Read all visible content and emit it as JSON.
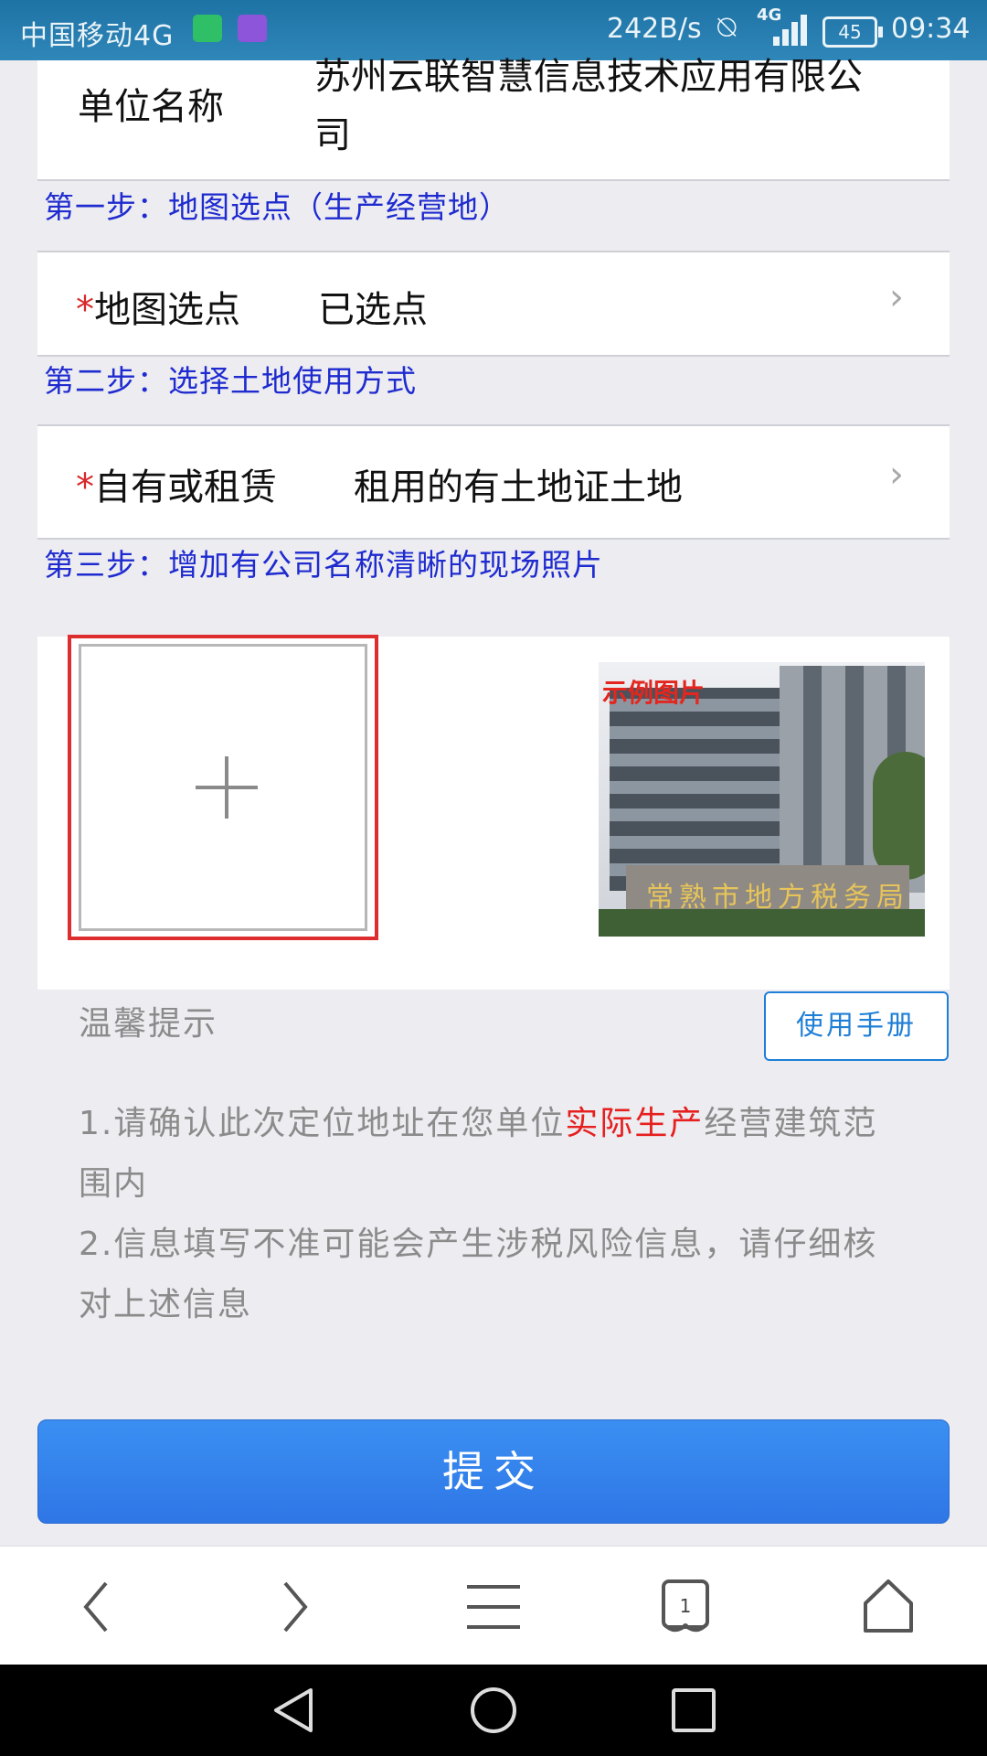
{
  "status_bar": {
    "carrier": "中国移动4G",
    "net_speed": "242B/s",
    "network_type": "4G",
    "battery": "45",
    "time": "09:34"
  },
  "form": {
    "unit_label": "单位名称",
    "unit_value": "苏州云联智慧信息技术应用有限公司",
    "step1": "第一步：地图选点（生产经营地）",
    "map_label": "地图选点",
    "map_value": "已选点",
    "step2": "第二步：选择土地使用方式",
    "ownership_label": "自有或租赁",
    "ownership_value": "租用的有土地证土地",
    "step3": "第三步：增加有公司名称清晰的现场照片",
    "required_mark": "*",
    "chevron": "›"
  },
  "photos": {
    "example_label": "示例图片",
    "example_sign": "常熟市地方税务局"
  },
  "tips": {
    "title": "温馨提示",
    "manual_button": "使用手册",
    "tip1_prefix": "1.请确认此次定位地址在您单位",
    "tip1_highlight": "实际生产",
    "tip1_suffix": "经营建筑范围内",
    "tip2": "2.信息填写不准可能会产生涉税风险信息，请仔细核对上述信息"
  },
  "submit_label": "提交",
  "browser": {
    "tab_count": "1",
    "icons": [
      "back-icon",
      "forward-icon",
      "menu-icon",
      "tabs-icon",
      "home-icon"
    ]
  },
  "colors": {
    "status_bar": "#2f86b8",
    "step_text": "#1f2bcf",
    "required": "#d8282c",
    "highlight": "#e61f1f",
    "submit": "#3a8ff2",
    "add_box_border": "#dd2d2f"
  }
}
